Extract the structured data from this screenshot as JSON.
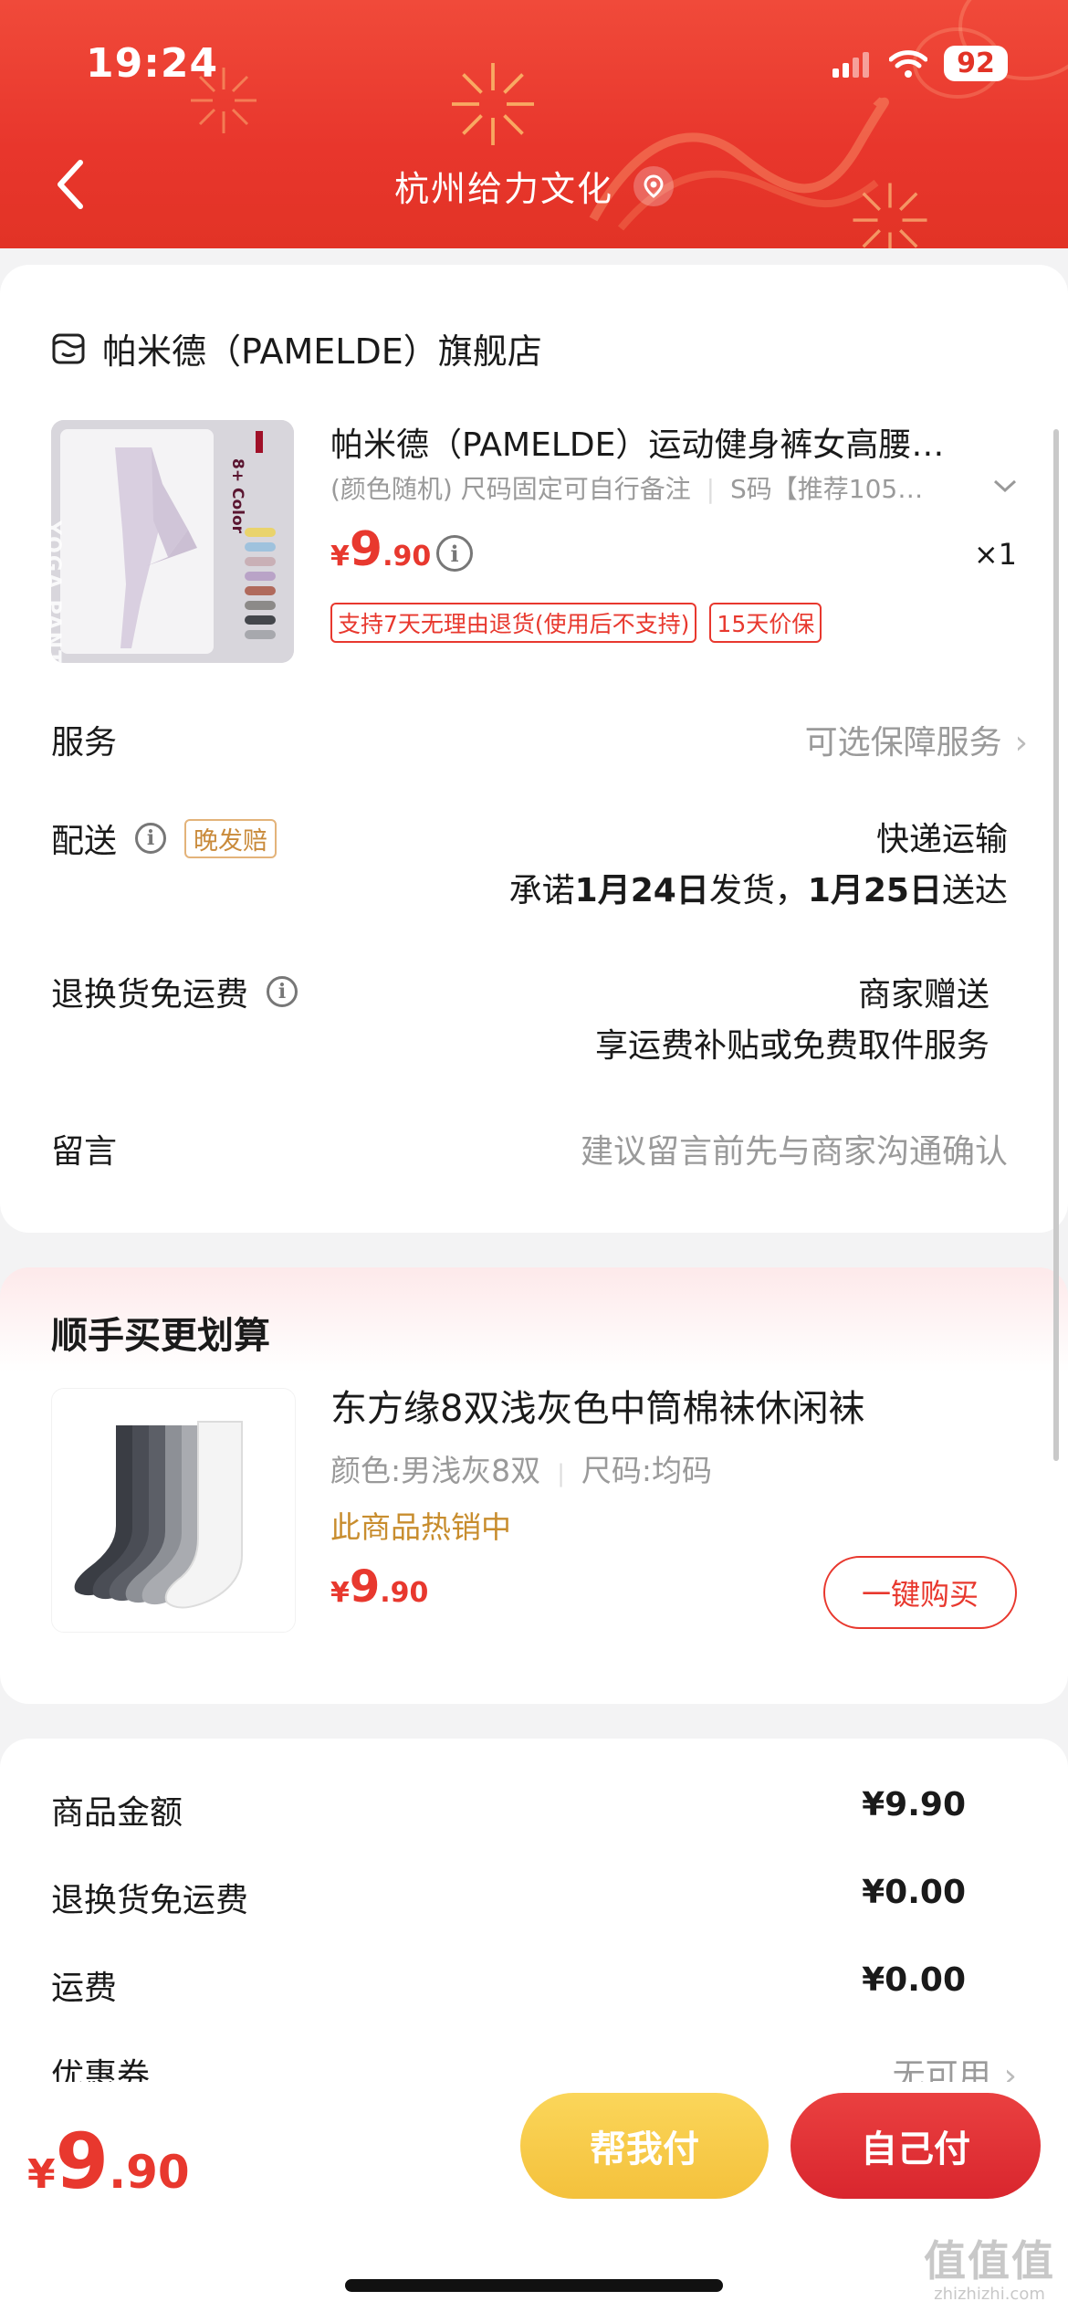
{
  "status_bar": {
    "time": "19:24",
    "battery": "92"
  },
  "header": {
    "title": "杭州给力文化"
  },
  "order": {
    "store_name": "帕米德（PAMELDE）旗舰店",
    "product": {
      "title": "帕米德（PAMELDE）运动健身裤女高腰…",
      "spec": "(颜色随机) 尺码固定可自行备注",
      "size": "S码【推荐105…",
      "price_currency": "¥",
      "price_int": "9",
      "price_dec": ".90",
      "quantity": "×1",
      "tags": [
        "支持7天无理由退货(使用后不支持)",
        "15天价保"
      ],
      "image_text": {
        "top": "8+ Color",
        "side": "YOGA PANTS"
      }
    },
    "service": {
      "label": "服务",
      "value": "可选保障服务"
    },
    "delivery": {
      "label": "配送",
      "badge": "晚发赔",
      "method": "快递运输",
      "promise_prefix": "承诺",
      "ship_date": "1月24日",
      "ship_text": "发货，",
      "arrive_date": "1月25日",
      "arrive_text": "送达"
    },
    "return_shipping": {
      "label": "退换货免运费",
      "value": "商家赠送",
      "sub": "享运费补贴或免费取件服务"
    },
    "message": {
      "label": "留言",
      "placeholder": "建议留言前先与商家沟通确认"
    }
  },
  "upsell": {
    "title": "顺手买更划算",
    "name": "东方缘8双浅灰色中筒棉袜休闲袜",
    "color": "颜色:男浅灰8双",
    "size": "尺码:均码",
    "hot": "此商品热销中",
    "price_currency": "¥",
    "price_int": "9",
    "price_dec": ".90",
    "button": "一键购买"
  },
  "summary": {
    "rows": [
      {
        "label": "商品金额",
        "value": "¥9.90"
      },
      {
        "label": "退换货免运费",
        "value": "¥0.00"
      },
      {
        "label": "运费",
        "value": "¥0.00"
      },
      {
        "label": "优惠券",
        "value": "无可用"
      }
    ]
  },
  "bottom": {
    "total_currency": "¥",
    "total_int": "9",
    "total_dec": ".90",
    "help_pay": "帮我付",
    "self_pay": "自己付"
  },
  "watermark": {
    "mark": "值值值",
    "text": "zhizhizhi.com"
  },
  "colors": {
    "accent": "#e8382e",
    "header_red": "#e8362c",
    "gold": "#c88d2e",
    "help_yellow": "#f4c13c"
  }
}
